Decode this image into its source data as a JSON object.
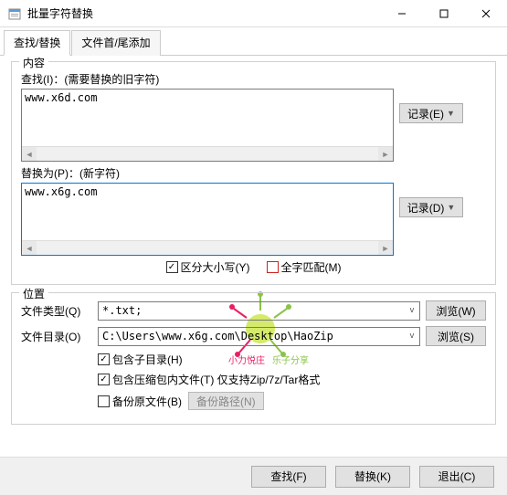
{
  "window": {
    "title": "批量字符替换",
    "min": "—",
    "max": "☐",
    "close": "✕"
  },
  "tabs": {
    "find_replace": "查找/替换",
    "append": "文件首/尾添加"
  },
  "content": {
    "group_title": "内容",
    "find_label": "查找(I)：(需要替换的旧字符)",
    "find_value": "www.x6d.com",
    "replace_label": "替换为(P)：(新字符)",
    "replace_value": "www.x6g.com",
    "record_e": "记录(E)",
    "record_d": "记录(D)",
    "case_sensitive": "区分大小写(Y)",
    "whole_word": "全字匹配(M)"
  },
  "location": {
    "group_title": "位置",
    "type_label": "文件类型(Q)",
    "type_value": "*.txt;",
    "dir_label": "文件目录(O)",
    "dir_value": "C:\\Users\\www.x6g.com\\Desktop\\HaoZip",
    "browse_w": "浏览(W)",
    "browse_s": "浏览(S)",
    "include_sub": "包含子目录(H)",
    "include_arch": "包含压缩包内文件(T) 仅支持Zip/7z/Tar格式",
    "backup_orig": "备份原文件(B)",
    "backup_path": "备份路径(N)"
  },
  "footer": {
    "find": "查找(F)",
    "replace": "替换(K)",
    "exit": "退出(C)"
  }
}
